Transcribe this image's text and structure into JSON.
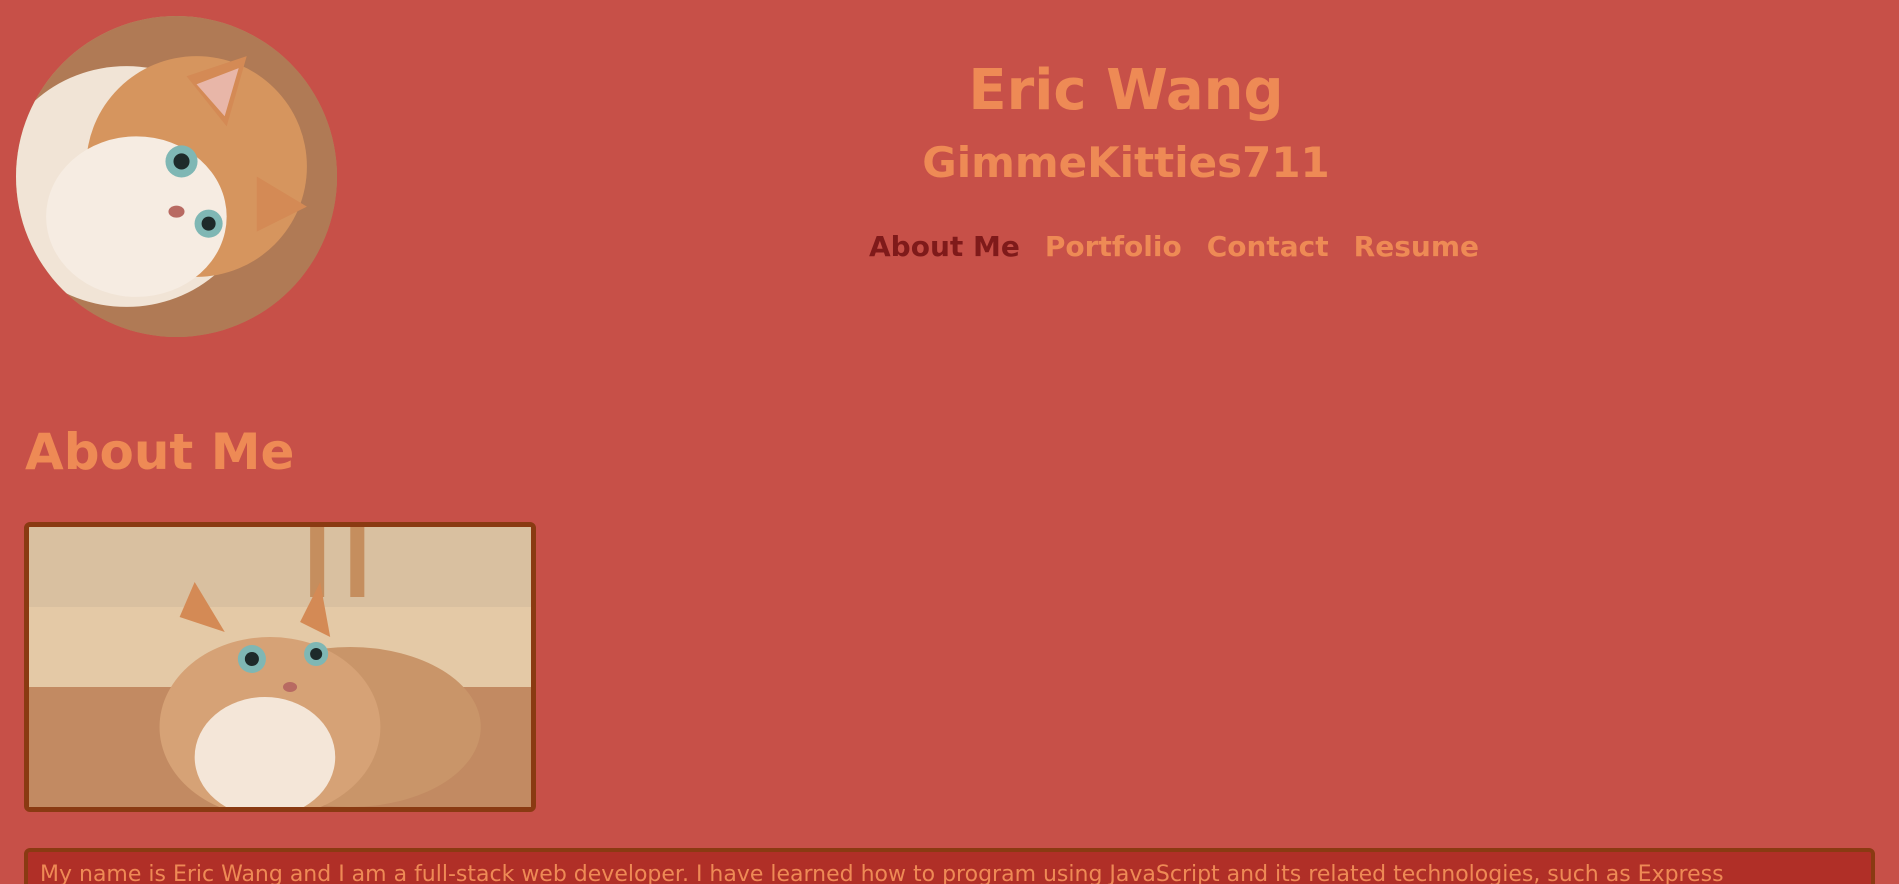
{
  "header": {
    "name": "Eric Wang",
    "handle": "GimmeKitties711"
  },
  "nav": {
    "items": [
      {
        "label": "About Me",
        "active": true
      },
      {
        "label": "Portfolio",
        "active": false
      },
      {
        "label": "Contact",
        "active": false
      },
      {
        "label": "Resume",
        "active": false
      }
    ]
  },
  "about": {
    "title": "About Me",
    "bio": "My name is Eric Wang and I am a full-stack web developer. I have learned how to program using JavaScript and its related technologies, such as Express"
  },
  "colors": {
    "background": "#c75048",
    "accent_text": "#ee8a55",
    "active_nav": "#7f1a1a",
    "frame_border": "#8a3a12",
    "bio_background": "#b02f27"
  }
}
